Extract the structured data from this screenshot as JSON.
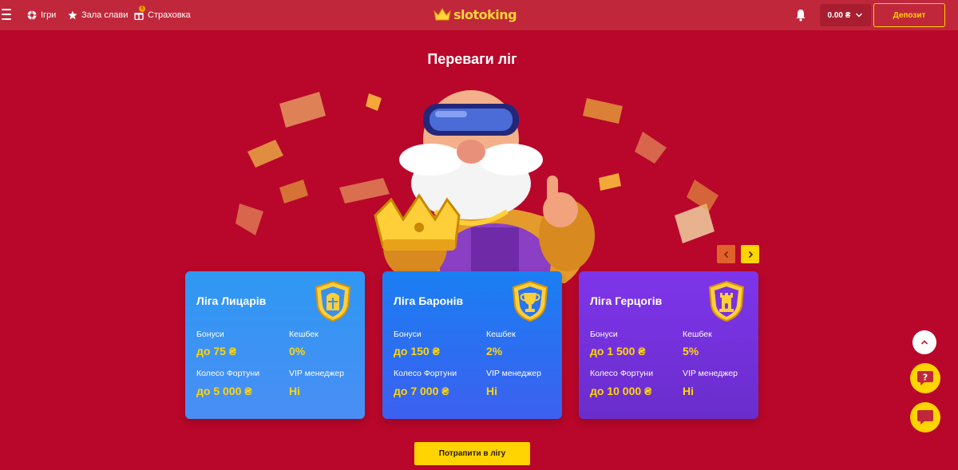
{
  "header": {
    "nav": {
      "games": "Ігри",
      "hall_of_fame": "Зала слави",
      "insurance": "Страховка"
    },
    "insurance_badge": "6",
    "logo_text": "slotoking",
    "balance": "0.00 ₴",
    "deposit_label": "Депозит"
  },
  "main": {
    "title": "Переваги ліг",
    "join_label": "Потрапити в лігу"
  },
  "cards": [
    {
      "name": "Ліга Лицарів",
      "bonus_label": "Бонуси",
      "bonus_value": "до 75 ₴",
      "cashback_label": "Кешбек",
      "cashback_value": "0%",
      "wheel_label": "Колесо Фортуни",
      "wheel_value": "до 5 000 ₴",
      "vip_label": "VIP менеджер",
      "vip_value": "Ні"
    },
    {
      "name": "Ліга Баронів",
      "bonus_label": "Бонуси",
      "bonus_value": "до 150 ₴",
      "cashback_label": "Кешбек",
      "cashback_value": "2%",
      "wheel_label": "Колесо Фортуни",
      "wheel_value": "до 7 000 ₴",
      "vip_label": "VIP менеджер",
      "vip_value": "Ні"
    },
    {
      "name": "Ліга Герцогів",
      "bonus_label": "Бонуси",
      "bonus_value": "до 1 500 ₴",
      "cashback_label": "Кешбек",
      "cashback_value": "5%",
      "wheel_label": "Колесо Фортуни",
      "wheel_value": "до 10 000 ₴",
      "vip_label": "VIP менеджер",
      "vip_value": "Ні"
    }
  ],
  "colors": {
    "background": "#b8072a",
    "header": "#c1273a",
    "accent_yellow": "#ffd400",
    "card_knights": "#2e98f3",
    "card_barons": "#1a7ff2",
    "card_dukes": "#7e35ea"
  },
  "icons": {
    "menu": "hamburger-icon",
    "games": "chip-icon",
    "fame": "star-icon",
    "insurance": "gift-icon",
    "notifications": "bell-icon",
    "help": "question-icon",
    "chat": "chat-icon"
  }
}
